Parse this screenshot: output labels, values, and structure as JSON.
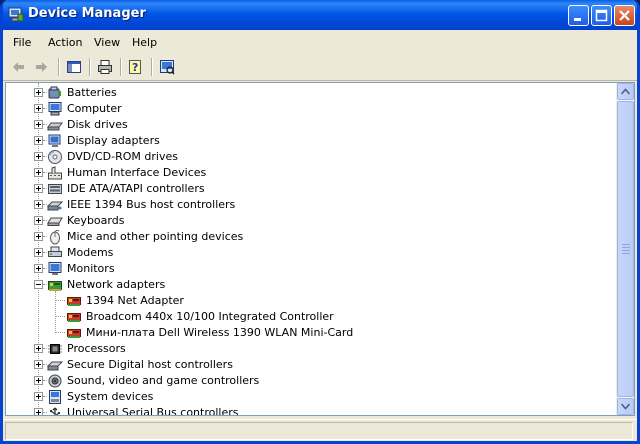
{
  "window": {
    "title": "Device Manager"
  },
  "menu": [
    {
      "label": "File"
    },
    {
      "label": "Action"
    },
    {
      "label": "View"
    },
    {
      "label": "Help"
    }
  ],
  "toolbar": [
    {
      "icon": "back-arrow-icon"
    },
    {
      "icon": "forward-arrow-icon"
    },
    {
      "icon": "show-hide-console-tree-icon"
    },
    {
      "icon": "print-icon"
    },
    {
      "icon": "help-icon"
    },
    {
      "icon": "scan-hardware-changes-icon"
    }
  ],
  "tree": [
    {
      "label": "Batteries",
      "expanded": false,
      "icon": "battery-icon"
    },
    {
      "label": "Computer",
      "expanded": false,
      "icon": "computer-icon"
    },
    {
      "label": "Disk drives",
      "expanded": false,
      "icon": "disk-drive-icon"
    },
    {
      "label": "Display adapters",
      "expanded": false,
      "icon": "display-adapter-icon"
    },
    {
      "label": "DVD/CD-ROM drives",
      "expanded": false,
      "icon": "cdrom-icon"
    },
    {
      "label": "Human Interface Devices",
      "expanded": false,
      "icon": "hid-icon"
    },
    {
      "label": "IDE ATA/ATAPI controllers",
      "expanded": false,
      "icon": "ide-controller-icon"
    },
    {
      "label": "IEEE 1394 Bus host controllers",
      "expanded": false,
      "icon": "ieee1394-icon"
    },
    {
      "label": "Keyboards",
      "expanded": false,
      "icon": "keyboard-icon"
    },
    {
      "label": "Mice and other pointing devices",
      "expanded": false,
      "icon": "mouse-icon"
    },
    {
      "label": "Modems",
      "expanded": false,
      "icon": "modem-icon"
    },
    {
      "label": "Monitors",
      "expanded": false,
      "icon": "monitor-icon"
    },
    {
      "label": "Network adapters",
      "expanded": true,
      "icon": "network-adapter-icon",
      "children": [
        {
          "label": "1394 Net Adapter",
          "icon": "network-card-icon"
        },
        {
          "label": "Broadcom 440x 10/100 Integrated Controller",
          "icon": "network-card-icon"
        },
        {
          "label": "Мини-плата Dell Wireless 1390 WLAN Mini-Card",
          "icon": "network-card-icon"
        }
      ]
    },
    {
      "label": "Processors",
      "expanded": false,
      "icon": "processor-icon"
    },
    {
      "label": "Secure Digital host controllers",
      "expanded": false,
      "icon": "sd-controller-icon"
    },
    {
      "label": "Sound, video and game controllers",
      "expanded": false,
      "icon": "sound-icon"
    },
    {
      "label": "System devices",
      "expanded": false,
      "icon": "system-devices-icon"
    },
    {
      "label": "Universal Serial Bus controllers",
      "expanded": false,
      "icon": "usb-icon"
    }
  ],
  "colors": {
    "titlebar": "#0054E3",
    "window_bg": "#ECE9D8",
    "tree_bg": "#FFFFFF"
  }
}
